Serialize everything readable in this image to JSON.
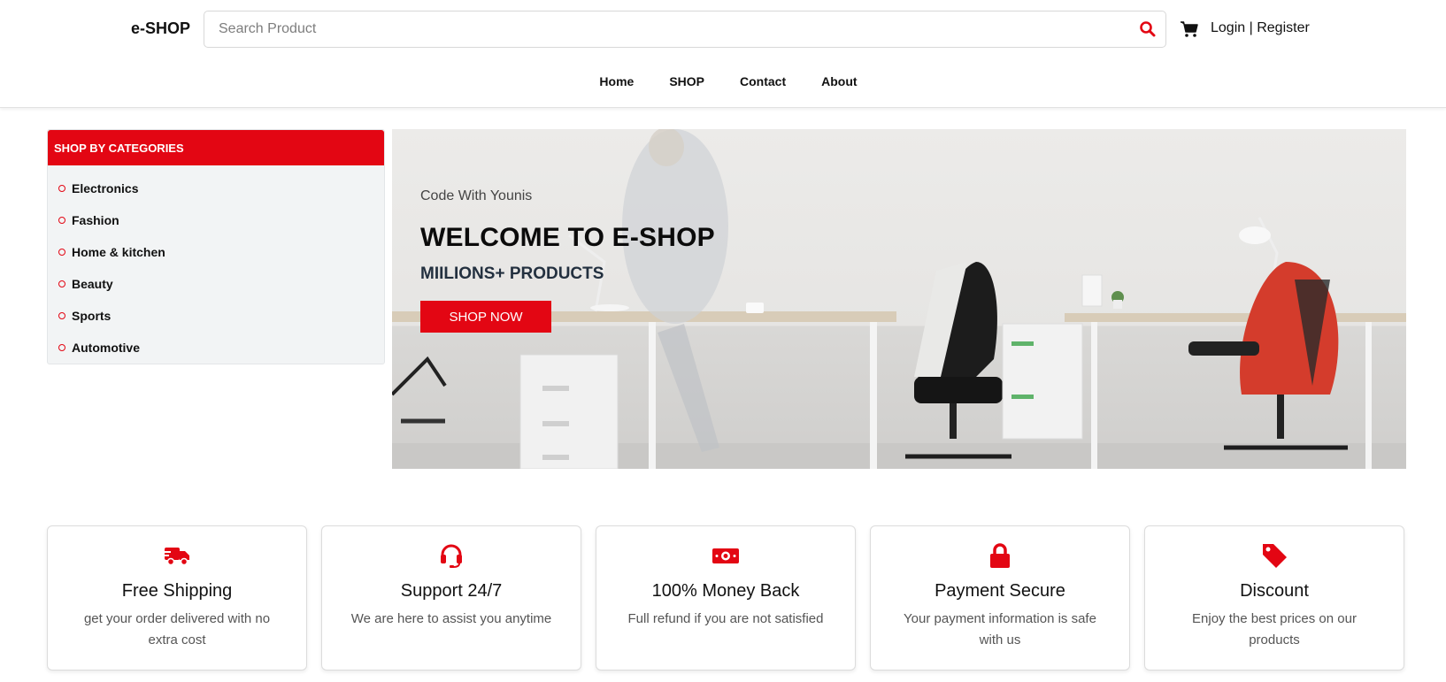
{
  "header": {
    "logo": "e-SHOP",
    "search_placeholder": "Search Product",
    "login": "Login",
    "separator": "|",
    "register": "Register",
    "icons": [
      "search-icon",
      "cart-icon"
    ],
    "accent_color": "#e30613"
  },
  "nav": [
    "Home",
    "SHOP",
    "Contact",
    "About"
  ],
  "categories": {
    "title": "SHOP BY CATEGORIES",
    "items": [
      "Electronics",
      "Fashion",
      "Home & kitchen",
      "Beauty",
      "Sports",
      "Automotive"
    ]
  },
  "hero": {
    "subtitle": "Code With Younis",
    "title": "WELCOME TO E-SHOP",
    "tagline": "MIILIONS+ PRODUCTS",
    "button": "SHOP NOW"
  },
  "features": [
    {
      "icon": "shipping-truck-icon",
      "title": "Free Shipping",
      "text": "get your order delivered with no extra cost"
    },
    {
      "icon": "headset-icon",
      "title": "Support 24/7",
      "text": "We are here to assist you anytime"
    },
    {
      "icon": "money-bill-icon",
      "title": "100% Money Back",
      "text": "Full refund if you are not satisfied"
    },
    {
      "icon": "lock-icon",
      "title": "Payment Secure",
      "text": "Your payment information is safe with us"
    },
    {
      "icon": "tag-icon",
      "title": "Discount",
      "text": "Enjoy the best prices on our products"
    }
  ]
}
